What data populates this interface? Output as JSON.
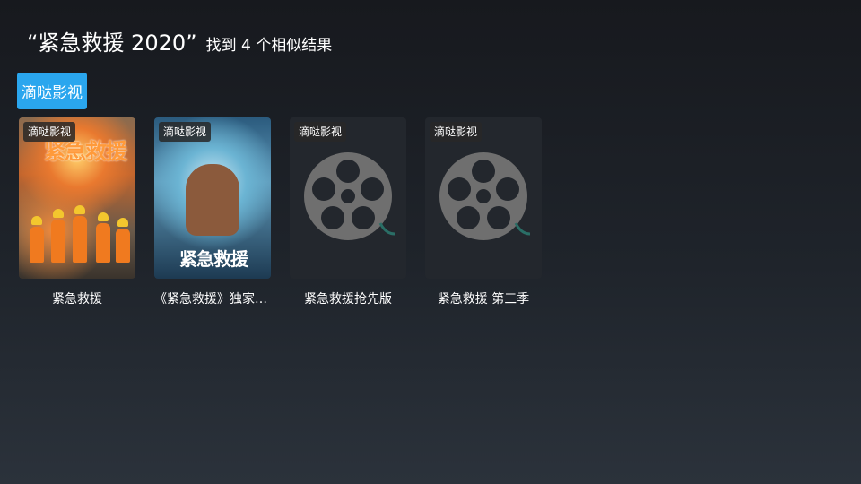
{
  "header": {
    "query": "“紧急救援 2020”",
    "result_count_text": "找到 4 个相似结果"
  },
  "source_tabs": [
    {
      "label": "滴哒影视",
      "selected": true
    }
  ],
  "results": [
    {
      "title": "紧急救援",
      "badge": "滴哒影视",
      "poster": "poster-image"
    },
    {
      "title": "《紧急救援》独家纪录片",
      "badge": "滴哒影视",
      "poster": "poster-image"
    },
    {
      "title": "紧急救援抢先版",
      "badge": "滴哒影视",
      "poster": "film-reel-icon"
    },
    {
      "title": "紧急救援 第三季",
      "badge": "滴哒影视",
      "poster": "film-reel-icon"
    }
  ],
  "colors": {
    "accent": "#2aa6ee",
    "background_top": "#17191e",
    "background_bottom": "#2b323b",
    "placeholder_reel": "#6f6f6f"
  }
}
